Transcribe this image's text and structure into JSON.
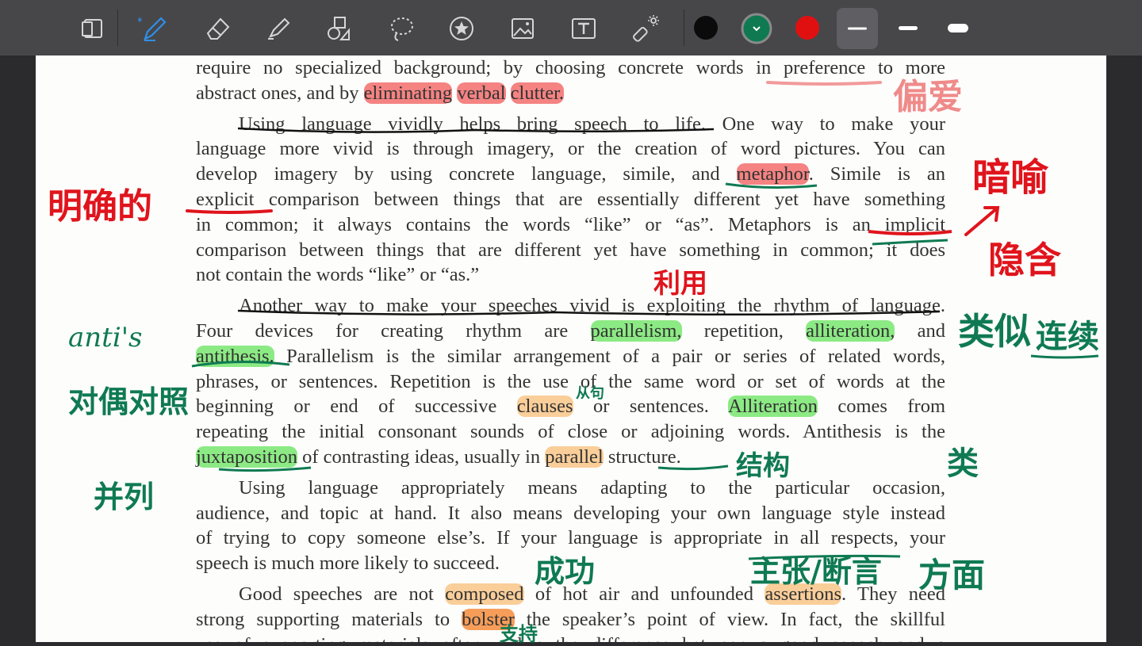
{
  "toolbar": {
    "tools": [
      {
        "name": "pages-icon"
      },
      {
        "name": "pen-icon"
      },
      {
        "name": "eraser-icon"
      },
      {
        "name": "highlighter-icon"
      },
      {
        "name": "shapes-icon"
      },
      {
        "name": "lasso-icon"
      },
      {
        "name": "sticker-star-icon"
      },
      {
        "name": "image-icon"
      },
      {
        "name": "text-box-icon"
      },
      {
        "name": "laser-pointer-icon"
      }
    ],
    "colors": [
      "#0b0b0b",
      "#0f7a52",
      "#e11010"
    ],
    "selected_color": "#0f7a52",
    "selected_width_index": 0
  },
  "doc": {
    "lines": [
      "require no specialized background; by choosing concrete words in preference to more",
      "abstract ones, and by eliminating verbal clutter.",
      "Using language vividly helps bring speech to life. One way to make your",
      "language more vivid is through imagery, or the creation of word pictures. You can",
      "develop imagery by using concrete language, simile, and metaphor. Simile is an",
      "explicit comparison between things that are essentially different yet have something",
      "in common; it always contains the words “like” or “as”. Metaphors is an implicit",
      "comparison between things that are different yet have something in common; it does",
      "not contain the words “like” or “as.”",
      "Another way to make your speeches vivid is exploiting the rhythm of language.",
      "Four devices for creating rhythm are parallelism, repetition, alliteration, and",
      "antithesis. Parallelism is the similar arrangement of a pair or series of related words,",
      "phrases, or sentences. Repetition is the use of the same word or set of words at the",
      "beginning or end of successive clauses or sentences. Alliteration comes from",
      "repeating the initial consonant sounds of close or adjoining words. Antithesis is the",
      "juxtaposition of contrasting ideas, usually in parallel structure.",
      "Using language appropriately means adapting to the particular occasion,",
      "audience, and topic at hand. It also means developing your own language style instead",
      "of trying to copy someone else’s. If your language is appropriate in all respects, your",
      "speech is much more likely to succeed.",
      "Good speeches are not composed of hot air and unfounded assertions. They need",
      "strong supporting materials to bolster the speaker’s point of view. In fact, the skillful",
      "use of supporting materials often makes the difference between a good speech and a"
    ]
  },
  "notes": {
    "preference": "偏爱",
    "explicit": "明确的",
    "metaphor": "暗喻",
    "implicit": "隐含",
    "exploit": "利用",
    "antithesis_en": "anti's",
    "antithesis_cn": "对偶对照",
    "similar": "类似",
    "series": "连续",
    "clause": "从句",
    "juxtaposition": "并列",
    "structure": "结构",
    "class": "类",
    "succeed": "成功",
    "assertion": "主张/断言",
    "aspect": "方面",
    "bolster": "支持"
  }
}
